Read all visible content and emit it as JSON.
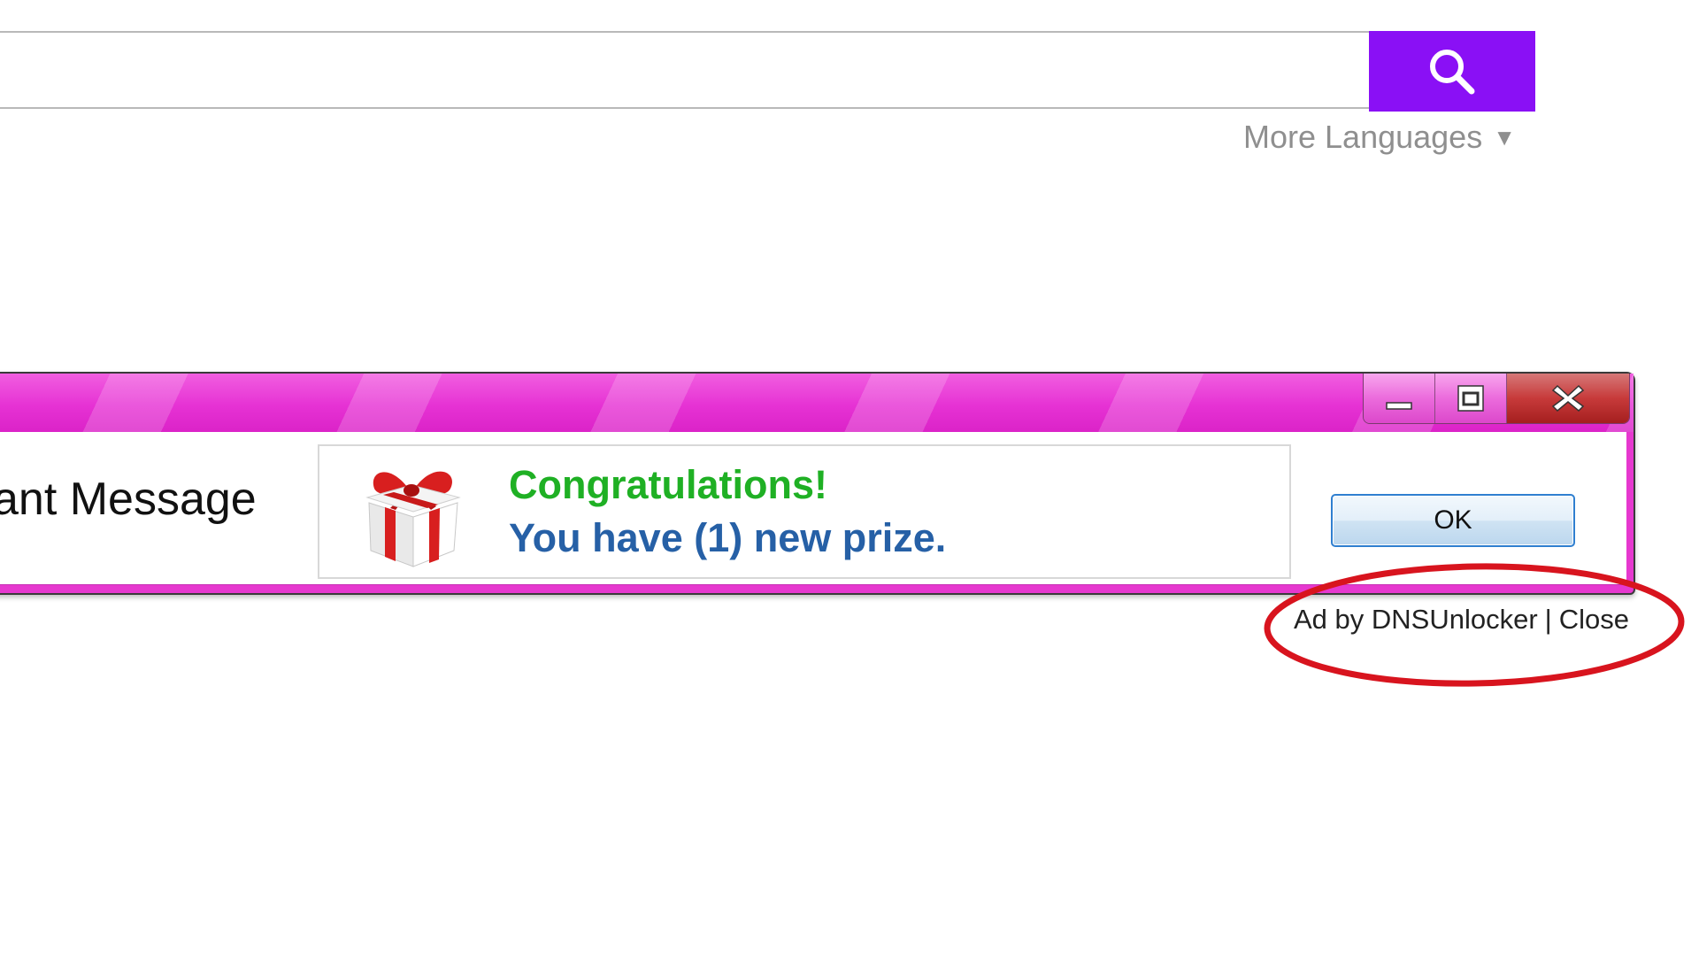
{
  "search": {
    "value": "",
    "placeholder": "",
    "button_icon": "search-icon",
    "accent_color": "#8a10f5"
  },
  "languages": {
    "label": "More Languages",
    "arrow": "▼"
  },
  "popup": {
    "title_color": "#e638cf",
    "message_title": "ant Message",
    "congrats": "Congratulations!",
    "prize_text": "You have (1) new prize.",
    "ok_label": "OK",
    "icons": [
      "minimize-icon",
      "maximize-icon",
      "close-icon",
      "gift-icon"
    ]
  },
  "ad": {
    "by_text": "Ad by DNSUnlocker",
    "separator": "|",
    "close_label": "Close",
    "highlight_color": "#d8141e"
  }
}
